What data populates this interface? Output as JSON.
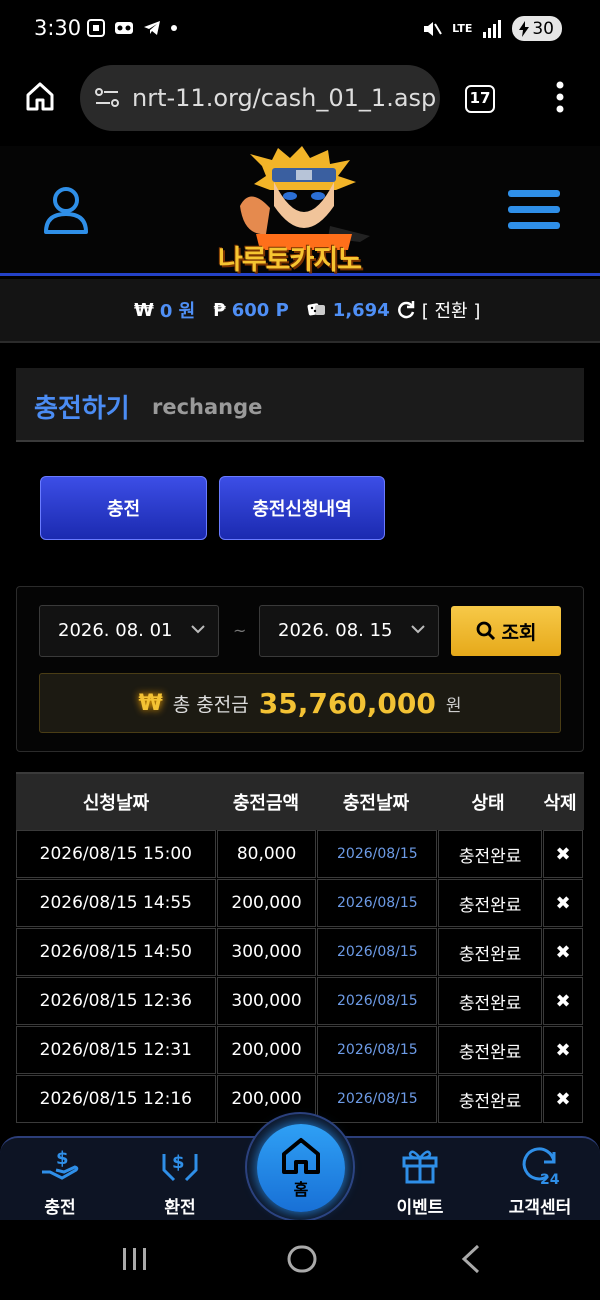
{
  "status_bar": {
    "time": "3:30",
    "network": "LTE",
    "battery": "30"
  },
  "browser": {
    "url": "nrt-11.org/cash_01_1.asp",
    "tab_count": "17"
  },
  "site": {
    "logo_text": "나루토카지노"
  },
  "balance": {
    "cash_symbol": "₩",
    "cash_value": "0 원",
    "point_symbol": "₱",
    "point_value": "600 P",
    "chip_value": "1,694",
    "convert_label": "[ 전환 ]"
  },
  "page": {
    "title_ko": "충전하기",
    "title_en": "rechange"
  },
  "tabs": [
    {
      "label": "충전"
    },
    {
      "label": "충전신청내역"
    }
  ],
  "search": {
    "start_date": "2026. 08. 01",
    "tilde": "~",
    "end_date": "2026. 08. 15",
    "button_label": "조회"
  },
  "total": {
    "icon": "₩",
    "label": "총 충전금",
    "amount": "35,760,000",
    "unit": "원"
  },
  "table": {
    "headers": [
      "신청날짜",
      "충전금액",
      "충전날짜",
      "상태",
      "삭제"
    ],
    "rows": [
      {
        "req_date": "2026/08/15 15:00",
        "amount": "80,000",
        "charge_date": "2026/08/15",
        "status": "충전완료",
        "delete": "✖"
      },
      {
        "req_date": "2026/08/15 14:55",
        "amount": "200,000",
        "charge_date": "2026/08/15",
        "status": "충전완료",
        "delete": "✖"
      },
      {
        "req_date": "2026/08/15 14:50",
        "amount": "300,000",
        "charge_date": "2026/08/15",
        "status": "충전완료",
        "delete": "✖"
      },
      {
        "req_date": "2026/08/15 12:36",
        "amount": "300,000",
        "charge_date": "2026/08/15",
        "status": "충전완료",
        "delete": "✖"
      },
      {
        "req_date": "2026/08/15 12:31",
        "amount": "200,000",
        "charge_date": "2026/08/15",
        "status": "충전완료",
        "delete": "✖"
      },
      {
        "req_date": "2026/08/15 12:16",
        "amount": "200,000",
        "charge_date": "2026/08/15",
        "status": "충전완료",
        "delete": "✖"
      }
    ]
  },
  "bottom_nav": {
    "charge": "충전",
    "exchange": "환전",
    "home": "홈",
    "event": "이벤트",
    "support": "고객센터"
  },
  "colors": {
    "accent_blue": "#4b8cf3",
    "gold": "#f3c234",
    "button_blue": "#2a3ad0"
  }
}
